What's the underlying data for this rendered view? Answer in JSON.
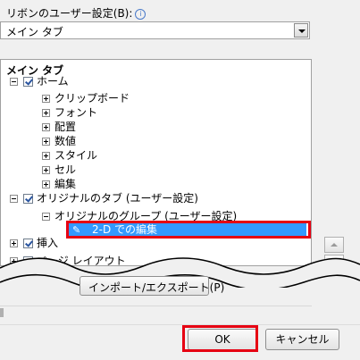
{
  "caption": {
    "label": "リボンのユーザー設定(B):",
    "info_icon": "info-icon"
  },
  "combo": {
    "value": "メイン タブ"
  },
  "tree": {
    "header": "メイン タブ",
    "home": "ホーム",
    "home_children": [
      "クリップボード",
      "フォント",
      "配置",
      "数値",
      "スタイル",
      "セル",
      "編集"
    ],
    "custom_tab": "オリジナルのタブ (ユーザー設定)",
    "custom_group": "オリジナルのグループ (ユーザー設定)",
    "selected_command": "2-D での編集",
    "insert": "挿入",
    "page_layout": "ページ レイアウト"
  },
  "buttons": {
    "import_export": "インポート/エクスポート(P)",
    "ok": "OK",
    "cancel": "キャンセル"
  },
  "colors": {
    "highlight": "#3399ff",
    "annotation": "#e60012"
  }
}
